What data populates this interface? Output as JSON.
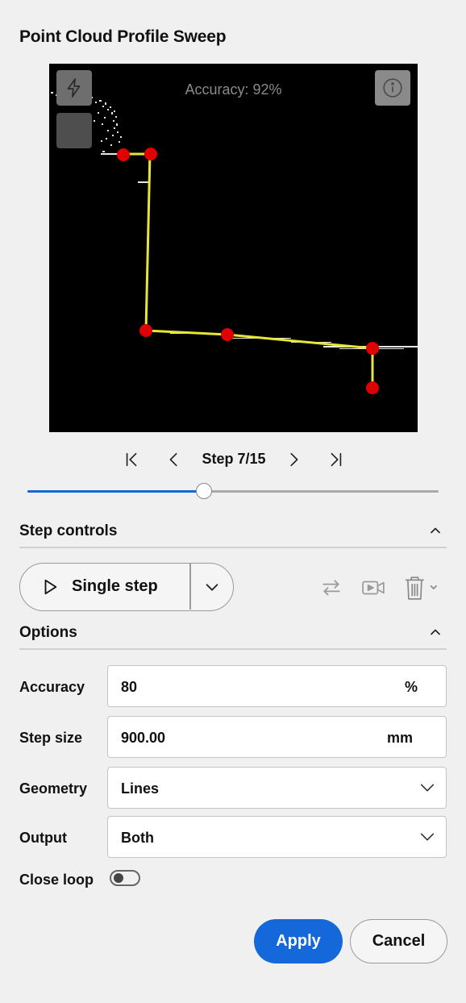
{
  "panel": {
    "title": "Point Cloud Profile Sweep"
  },
  "viewport": {
    "accuracy_text": "Accuracy: 92%",
    "icons": [
      "lightning-icon",
      "square-icon",
      "info-icon"
    ]
  },
  "navigation": {
    "step_label": "Step 7/15",
    "current_step": 7,
    "total_steps": 15,
    "progress_fraction": 0.43
  },
  "step_controls": {
    "header": "Step controls",
    "single_step_label": "Single step",
    "tool_icons": [
      "swap-icon",
      "record-video-icon",
      "trash-icon"
    ]
  },
  "options": {
    "header": "Options",
    "accuracy": {
      "label": "Accuracy",
      "value": "80",
      "unit": "%"
    },
    "step_size": {
      "label": "Step size",
      "value": "900.00",
      "unit": "mm"
    },
    "geometry": {
      "label": "Geometry",
      "value": "Lines"
    },
    "output": {
      "label": "Output",
      "value": "Both"
    },
    "close_loop": {
      "label": "Close loop",
      "on": false
    }
  },
  "actions": {
    "apply_label": "Apply",
    "cancel_label": "Cancel"
  },
  "colors": {
    "accent": "#1568d9",
    "profile_line": "#e6e635",
    "vertex": "#e00000",
    "point_cloud": "#ffffff"
  }
}
